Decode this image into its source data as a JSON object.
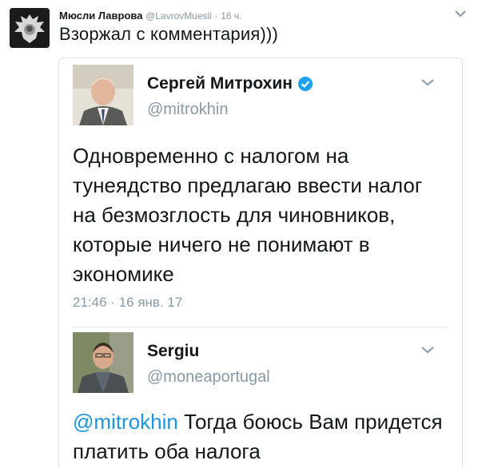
{
  "outer_tweet": {
    "author_name": "Мюсли Лаврова",
    "author_handle": "@LavrovMuesli",
    "separator": "·",
    "time": "16 ч.",
    "text": "Взоржал с комментария)))",
    "avatar_icon": "double-headed-eagle-avatar",
    "menu_icon": "chevron-down-icon"
  },
  "quoted_tweet": {
    "author_name": "Сергей Митрохин",
    "verified_icon": "verified-badge-icon",
    "verified_color": "#1da1f2",
    "author_handle": "@mitrokhin",
    "text": "Одновременно с налогом на тунеядство предлагаю ввести налог на безмозглость для чиновников, которые ничего не понимают в экономике",
    "time": "21:46",
    "separator": "·",
    "date": "16 янв. 17",
    "menu_icon": "chevron-down-icon"
  },
  "reply_tweet": {
    "author_name": "Sergiu",
    "author_handle": "@moneaportugal",
    "mention": "@mitrokhin",
    "text": " Тогда боюсь Вам придется платить оба налога",
    "mention_color": "#1b95e0",
    "menu_icon": "chevron-down-icon"
  }
}
